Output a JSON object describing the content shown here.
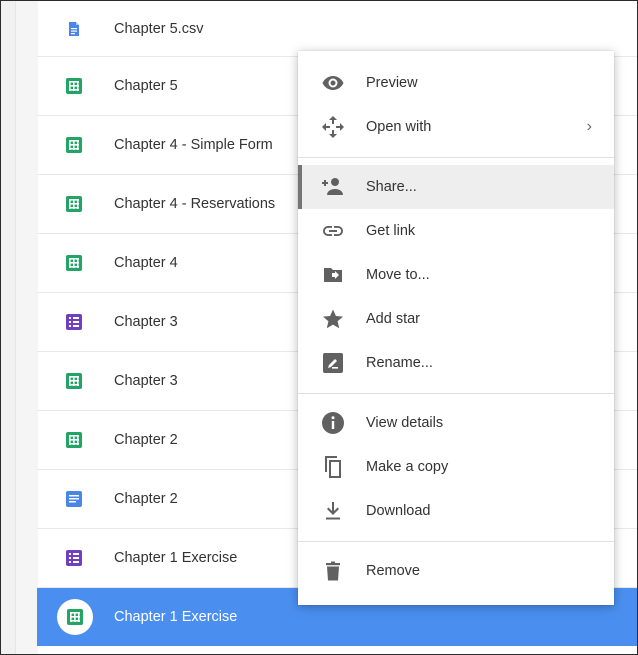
{
  "files": [
    {
      "name": "Chapter 5.csv",
      "type": "csv"
    },
    {
      "name": "Chapter 5",
      "type": "sheet"
    },
    {
      "name": "Chapter 4 - Simple Form",
      "type": "sheet"
    },
    {
      "name": "Chapter 4 - Reservations",
      "type": "sheet"
    },
    {
      "name": "Chapter 4",
      "type": "sheet"
    },
    {
      "name": "Chapter 3",
      "type": "form"
    },
    {
      "name": "Chapter 3",
      "type": "sheet"
    },
    {
      "name": "Chapter 2",
      "type": "sheet"
    },
    {
      "name": "Chapter 2",
      "type": "doc"
    },
    {
      "name": "Chapter 1 Exercise",
      "type": "form"
    },
    {
      "name": "Chapter 1 Exercise",
      "type": "sheet"
    }
  ],
  "context_menu": {
    "preview": "Preview",
    "open_with": "Open with",
    "share": "Share...",
    "get_link": "Get link",
    "move_to": "Move to...",
    "add_star": "Add star",
    "rename": "Rename...",
    "view_details": "View details",
    "make_a_copy": "Make a copy",
    "download": "Download",
    "remove": "Remove"
  },
  "colors": {
    "selected_row": "#4a8ff0",
    "sheet": "#21a464",
    "form": "#6e3fc3",
    "doc": "#4a86e8"
  }
}
